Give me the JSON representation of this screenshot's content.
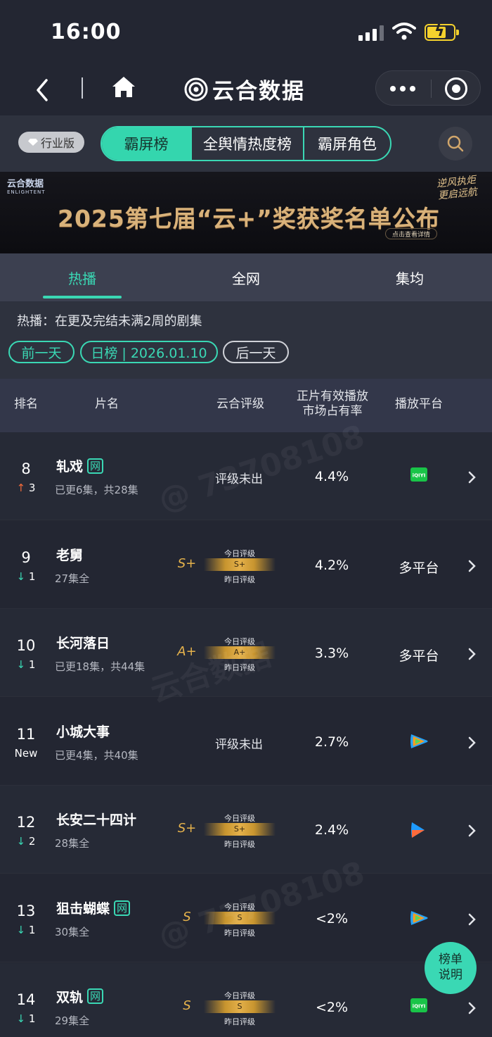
{
  "status_bar": {
    "time": "16:00"
  },
  "nav": {
    "title": "云合数据"
  },
  "categories": {
    "edition": "行业版",
    "tabs": [
      "霸屏榜",
      "全舆情热度榜",
      "霸屏角色"
    ]
  },
  "banner": {
    "logo": "云合数据",
    "logo_sub": "ENLIGHTENT",
    "headline": "2025第七届“云+”奖获奖名单公布",
    "cta": "点击查看详情",
    "slogan": "逆风执炬 更启远航"
  },
  "subtabs": [
    "热播",
    "全网",
    "集均"
  ],
  "date_area": {
    "description": "热播：在更及完结未满2周的剧集",
    "prev": "前一天",
    "current": "日榜 | 2026.01.10",
    "next": "后一天"
  },
  "table": {
    "headers": {
      "rank": "排名",
      "name": "片名",
      "rating": "云合评级",
      "share_line1": "正片有效播放",
      "share_line2": "市场占有率",
      "platform": "播放平台"
    },
    "rating_labels": {
      "today": "今日评级",
      "yesterday": "昨日评级"
    },
    "rows": [
      {
        "rank": "8",
        "trend": "↑",
        "trend_dir": "up",
        "trend_val": "3",
        "name": "轧戏",
        "badge": "网",
        "sub": "已更6集，共28集",
        "rating": "评级未出",
        "grade": "",
        "bar_grade": "",
        "share": "4.4%",
        "platform": "",
        "platform_icon": "iqiyi-icon"
      },
      {
        "rank": "9",
        "trend": "↓",
        "trend_dir": "down",
        "trend_val": "1",
        "name": "老舅",
        "badge": "",
        "sub": "27集全",
        "rating": "",
        "grade": "S+",
        "bar_grade": "S+",
        "share": "4.2%",
        "platform": "多平台",
        "platform_icon": ""
      },
      {
        "rank": "10",
        "trend": "↓",
        "trend_dir": "down",
        "trend_val": "1",
        "name": "长河落日",
        "badge": "",
        "sub": "已更18集，共44集",
        "rating": "",
        "grade": "A+",
        "bar_grade": "A+",
        "share": "3.3%",
        "platform": "多平台",
        "platform_icon": ""
      },
      {
        "rank": "11",
        "trend": "New",
        "trend_dir": "new",
        "trend_val": "",
        "name": "小城大事",
        "badge": "",
        "sub": "已更4集，共40集",
        "rating": "评级未出",
        "grade": "",
        "bar_grade": "",
        "share": "2.7%",
        "platform": "",
        "platform_icon": "tencent-video-icon"
      },
      {
        "rank": "12",
        "trend": "↓",
        "trend_dir": "down",
        "trend_val": "2",
        "name": "长安二十四计",
        "badge": "",
        "sub": "28集全",
        "rating": "",
        "grade": "S+",
        "bar_grade": "S+",
        "share": "2.4%",
        "platform": "",
        "platform_icon": "youku-icon"
      },
      {
        "rank": "13",
        "trend": "↓",
        "trend_dir": "down",
        "trend_val": "1",
        "name": "狙击蝴蝶",
        "badge": "网",
        "sub": "30集全",
        "rating": "",
        "grade": "S",
        "bar_grade": "S",
        "share": "<2%",
        "platform": "",
        "platform_icon": "tencent-video-icon"
      },
      {
        "rank": "14",
        "trend": "↓",
        "trend_dir": "down",
        "trend_val": "1",
        "name": "双轨",
        "badge": "网",
        "sub": "29集全",
        "rating": "",
        "grade": "S",
        "bar_grade": "S",
        "share": "<2%",
        "platform": "",
        "platform_icon": "iqiyi-icon"
      }
    ]
  },
  "fab": {
    "line1": "榜单",
    "line2": "说明"
  },
  "colors": {
    "accent": "#3ad8b4",
    "up": "#f06a3a",
    "grade": "#e6b34c",
    "background": "#232632"
  }
}
